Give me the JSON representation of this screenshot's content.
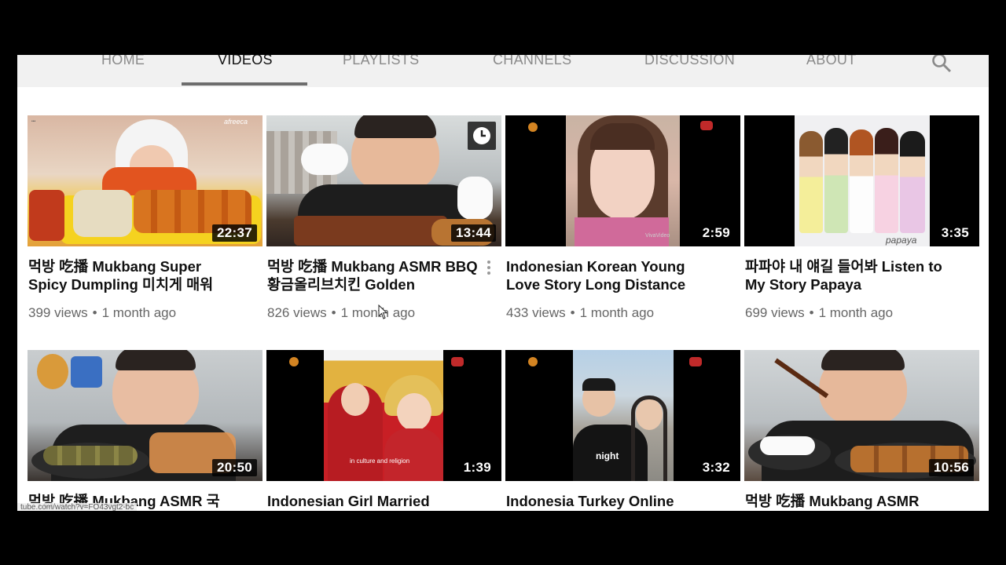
{
  "tabs": [
    "HOME",
    "VIDEOS",
    "PLAYLISTS",
    "CHANNELS",
    "DISCUSSION",
    "ABOUT"
  ],
  "active_tab": "VIDEOS",
  "icons": {
    "search": "search-icon",
    "watch_later": "clock-icon",
    "menu": "more-vert-icon"
  },
  "videos": [
    {
      "title": "먹방 吃播 Mukbang Super Spicy Dumpling 미치게 매워",
      "duration": "22:37",
      "views": "399 views",
      "age": "1 month ago",
      "channel_mark": "afreeca"
    },
    {
      "title": "먹방 吃播 Mukbang ASMR BBQ황금올리브치킨 Golden",
      "duration": "13:44",
      "views": "826 views",
      "age": "1 month ago"
    },
    {
      "title": "Indonesian Korean Young Love Story Long Distance",
      "duration": "2:59",
      "views": "433 views",
      "age": "1 month ago",
      "channel_mark": "VivaVideo"
    },
    {
      "title": "파파야 내 얘길 들어봐 Listen to My Story Papaya",
      "duration": "3:35",
      "views": "699 views",
      "age": "1 month ago",
      "channel_mark": "papaya"
    },
    {
      "title": "먹방 吃播 Mukbang ASMR 국",
      "duration": "20:50"
    },
    {
      "title": "Indonesian Girl Married",
      "duration": "1:39",
      "caption": "in culture and religion"
    },
    {
      "title": "Indonesia Turkey Online",
      "duration": "3:32",
      "shirt_text": "night"
    },
    {
      "title": "먹방 吃播 Mukbang ASMR",
      "duration": "10:56"
    }
  ],
  "status_url": "tube.com/watch?v=FO43vgt2-bc",
  "colors": {
    "background": "#000000",
    "tab_bar": "#f1f1f1",
    "active_tab": "#111111",
    "inactive_tab": "#8a8a8a",
    "meta_text": "#666666"
  }
}
